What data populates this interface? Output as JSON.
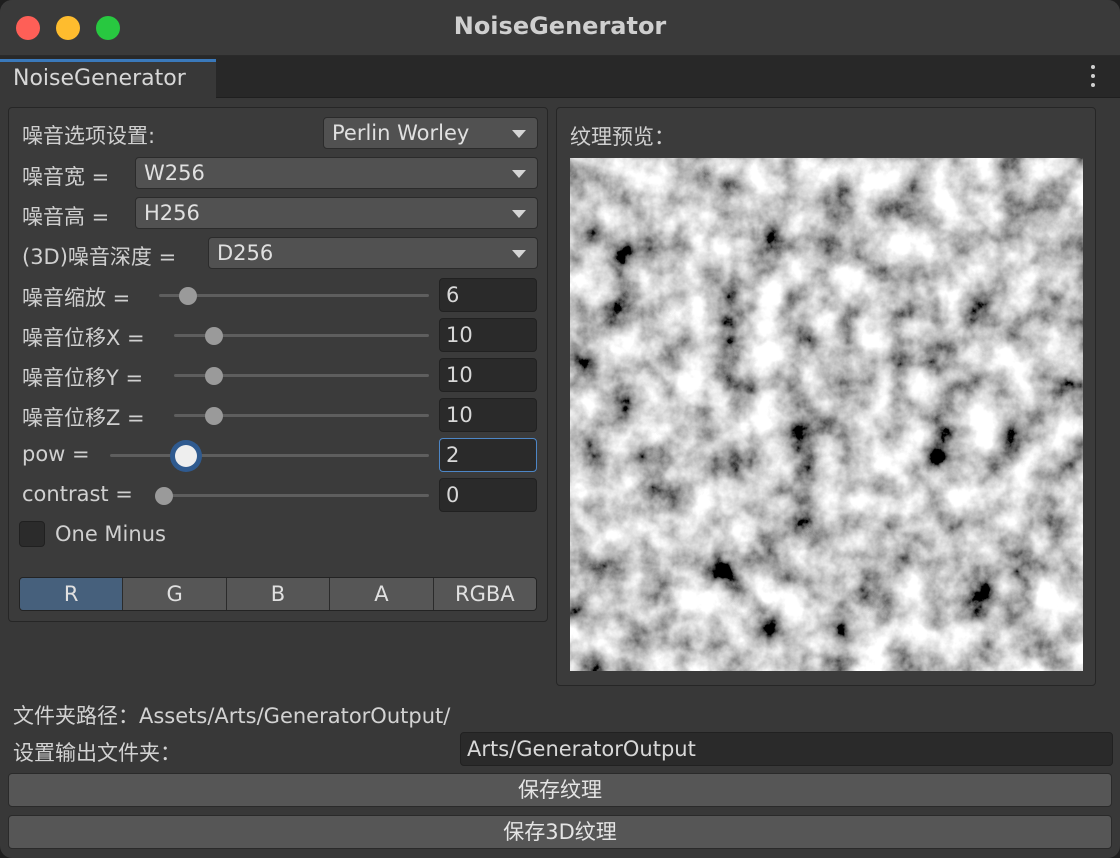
{
  "window": {
    "title": "NoiseGenerator"
  },
  "tab": {
    "label": "NoiseGenerator"
  },
  "settings": {
    "noise_options_label": "噪音选项设置:",
    "noise_type": "Perlin Worley",
    "width_label": "噪音宽 =",
    "width_value": "W256",
    "height_label": "噪音高 =",
    "height_value": "H256",
    "depth_label": "(3D)噪音深度 =",
    "depth_value": "D256"
  },
  "sliders": [
    {
      "label": "噪音缩放 =",
      "value": "6",
      "fraction": 0.08
    },
    {
      "label": "噪音位移X =",
      "value": "10",
      "fraction": 0.13
    },
    {
      "label": "噪音位移Y =",
      "value": "10",
      "fraction": 0.13
    },
    {
      "label": "噪音位移Z =",
      "value": "10",
      "fraction": 0.13
    },
    {
      "label": "pow =",
      "value": "2",
      "fraction": 0.22
    },
    {
      "label": "contrast =",
      "value": "0",
      "fraction": 0.0
    }
  ],
  "one_minus": {
    "label": "One Minus",
    "checked": false
  },
  "channels": {
    "options": [
      "R",
      "G",
      "B",
      "A",
      "RGBA"
    ],
    "selected": "R"
  },
  "preview": {
    "label": "纹理预览："
  },
  "output": {
    "folder_path_label": "文件夹路径：Assets/Arts/GeneratorOutput/",
    "set_folder_label": "设置输出文件夹：",
    "folder_value": "Arts/GeneratorOutput"
  },
  "buttons": {
    "save_texture": "保存纹理",
    "save_3d_texture": "保存3D纹理"
  },
  "colors": {
    "accent": "#3a79bb",
    "selected_segment": "#46607c",
    "panel": "#3b3b3b"
  }
}
